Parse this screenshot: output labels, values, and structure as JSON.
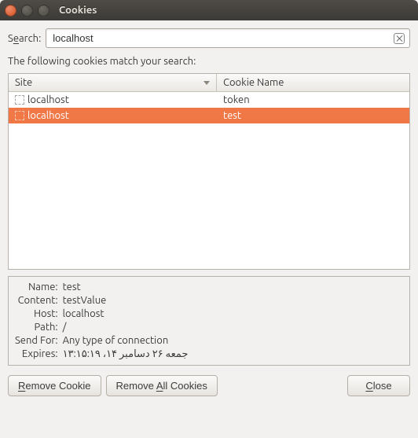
{
  "window": {
    "title": "Cookies"
  },
  "search": {
    "label_pre": "S",
    "label_underlined": "e",
    "label_post": "arch:",
    "value": "localhost"
  },
  "match_label": "The following cookies match your search:",
  "table": {
    "headers": {
      "site": "Site",
      "cookie": "Cookie Name"
    },
    "rows": [
      {
        "site": "localhost",
        "cookie": "token",
        "selected": false
      },
      {
        "site": "localhost",
        "cookie": "test",
        "selected": true
      }
    ]
  },
  "details": {
    "labels": {
      "name": "Name:",
      "content": "Content:",
      "host": "Host:",
      "path": "Path:",
      "send_for": "Send For:",
      "expires": "Expires:"
    },
    "values": {
      "name": "test",
      "content": "testValue",
      "host": "localhost",
      "path": "/",
      "send_for": "Any type of connection",
      "expires": "جمعه ۲۶ دسامبر ۱۴، ۱۳:۱۵:۱۹"
    }
  },
  "buttons": {
    "remove_cookie_pre": "",
    "remove_cookie_u": "R",
    "remove_cookie_post": "emove Cookie",
    "remove_all_pre": "Remove ",
    "remove_all_u": "A",
    "remove_all_post": "ll Cookies",
    "close_pre": "",
    "close_u": "C",
    "close_post": "lose"
  }
}
